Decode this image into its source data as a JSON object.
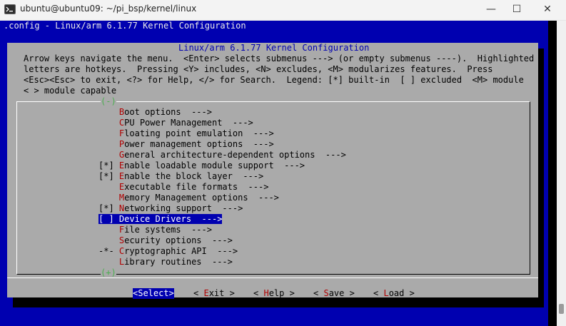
{
  "window": {
    "title": "ubuntu@ubuntu09: ~/pi_bsp/kernel/linux",
    "controls": [
      "—",
      "☐",
      "✕"
    ]
  },
  "terminal": {
    "header": ".config - Linux/arm 6.1.77 Kernel Configuration",
    "dialog_title": "Linux/arm 6.1.77 Kernel Configuration",
    "help_lines": [
      "Arrow keys navigate the menu.  <Enter> selects submenus ---> (or empty submenus ----).  Highlighted",
      "letters are hotkeys.  Pressing <Y> includes, <N> excludes, <M> modularizes features.  Press",
      "<Esc><Esc> to exit, <?> for Help, </> for Search.  Legend: [*] built-in  [ ] excluded  <M> module",
      "< > module capable"
    ],
    "menu_items": [
      {
        "prefix": "   ",
        "hot": "B",
        "rest": "oot options  --->",
        "selected": false
      },
      {
        "prefix": "   ",
        "hot": "C",
        "rest": "PU Power Management  --->",
        "selected": false
      },
      {
        "prefix": "   ",
        "hot": "F",
        "rest": "loating point emulation  --->",
        "selected": false
      },
      {
        "prefix": "   ",
        "hot": "P",
        "rest": "ower management options  --->",
        "selected": false
      },
      {
        "prefix": "   ",
        "hot": "G",
        "rest": "eneral architecture-dependent options  --->",
        "selected": false
      },
      {
        "prefix": "[*]",
        "hot": "E",
        "rest": "nable loadable module support  --->",
        "selected": false
      },
      {
        "prefix": "[*]",
        "hot": "E",
        "rest": "nable the block layer  --->",
        "selected": false
      },
      {
        "prefix": "   ",
        "hot": "E",
        "rest": "xecutable file formats  --->",
        "selected": false
      },
      {
        "prefix": "   ",
        "hot": "M",
        "rest": "emory Management options  --->",
        "selected": false
      },
      {
        "prefix": "[*]",
        "hot": "N",
        "rest": "etworking support  --->",
        "selected": false
      },
      {
        "prefix": "[ ]",
        "hot": "D",
        "rest": "evice Drivers  --->",
        "selected": true
      },
      {
        "prefix": "   ",
        "hot": "F",
        "rest": "ile systems  --->",
        "selected": false
      },
      {
        "prefix": "   ",
        "hot": "S",
        "rest": "ecurity options  --->",
        "selected": false
      },
      {
        "prefix": "-*-",
        "hot": "C",
        "rest": "ryptographic API  --->",
        "selected": false
      },
      {
        "prefix": "   ",
        "hot": "L",
        "rest": "ibrary routines  --->",
        "selected": false
      }
    ],
    "buttons": [
      {
        "label": "<Select>",
        "selected": true
      },
      {
        "label": "< Exit >",
        "hot": "E",
        "selected": false
      },
      {
        "label": "< Help >",
        "hot": "H",
        "selected": false
      },
      {
        "label": "< Save >",
        "hot": "S",
        "selected": false
      },
      {
        "label": "< Load >",
        "hot": "L",
        "selected": false
      }
    ],
    "scroll_top_indicator": "(-)",
    "scroll_bottom_indicator": "(+)",
    "colors": {
      "background_blue": "#0000b0",
      "dialog_gray": "#aaaaaa",
      "hotkey_red": "#b00000"
    }
  }
}
